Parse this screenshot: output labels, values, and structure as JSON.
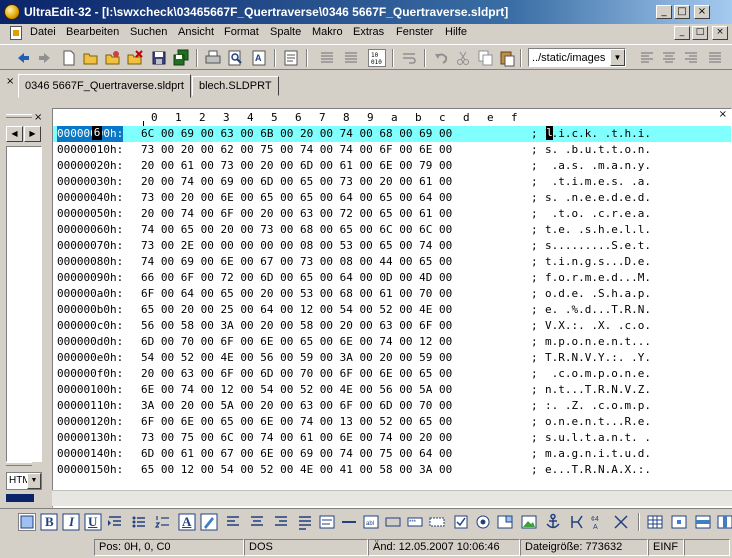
{
  "window": {
    "title": "UltraEdit-32 - [I:\\swxcheck\\03465667F_Quertraverse\\0346 5667F_Quertraverse.sldprt]"
  },
  "window_controls": {
    "minimize": "_",
    "restore": "□",
    "close": "×"
  },
  "mdi_controls": {
    "minimize": "_",
    "restore": "□",
    "close": "×"
  },
  "menu": {
    "items": [
      "Datei",
      "Bearbeiten",
      "Suchen",
      "Ansicht",
      "Format",
      "Spalte",
      "Makro",
      "Extras",
      "Fenster",
      "Hilfe"
    ]
  },
  "toolbar": {
    "path_value": "../static/images",
    "icons": [
      "back-icon",
      "forward-icon",
      "new-file-icon",
      "open-folder-icon",
      "open-recent-icon",
      "close-file-icon",
      "save-icon",
      "save-all-icon",
      "print-icon",
      "print-preview-icon",
      "spell-check-icon",
      "document-icon",
      "list-icon",
      "hex-mode-icon",
      "word-wrap-icon",
      "undo-icon",
      "cut-icon",
      "copy-icon",
      "paste-icon",
      "align-left-icon",
      "align-center-icon",
      "align-right-icon",
      "justify-icon"
    ]
  },
  "tabs": {
    "close": "×",
    "items": [
      {
        "label": "0346 5667F_Quertraverse.sldprt",
        "active": true
      },
      {
        "label": "blech.SLDPRT",
        "active": false
      }
    ]
  },
  "left_panel": {
    "close": "×",
    "prev": "◀",
    "next": "▶",
    "combo_value": "HTML"
  },
  "editor": {
    "corner_close": "×",
    "ruler": [
      "0",
      "1",
      "2",
      "3",
      "4",
      "5",
      "6",
      "7",
      "8",
      "9",
      "a",
      "b",
      "c",
      "d",
      "e",
      "f"
    ],
    "cursor_hex": "6",
    "cursor_ascii": "l",
    "rows": [
      {
        "addr": "00000000h:",
        "hex": "6C 00 69 00 63 00 6B 00 20 00 74 00 68 00 69 00",
        "sep": ";",
        "ascii": "l.i.c.k. .t.h.i."
      },
      {
        "addr": "00000010h:",
        "hex": "73 00 20 00 62 00 75 00 74 00 74 00 6F 00 6E 00",
        "sep": ";",
        "ascii": "s. .b.u.t.t.o.n."
      },
      {
        "addr": "00000020h:",
        "hex": "20 00 61 00 73 00 20 00 6D 00 61 00 6E 00 79 00",
        "sep": ";",
        "ascii": " .a.s. .m.a.n.y."
      },
      {
        "addr": "00000030h:",
        "hex": "20 00 74 00 69 00 6D 00 65 00 73 00 20 00 61 00",
        "sep": ";",
        "ascii": " .t.i.m.e.s. .a."
      },
      {
        "addr": "00000040h:",
        "hex": "73 00 20 00 6E 00 65 00 65 00 64 00 65 00 64 00",
        "sep": ";",
        "ascii": "s. .n.e.e.d.e.d."
      },
      {
        "addr": "00000050h:",
        "hex": "20 00 74 00 6F 00 20 00 63 00 72 00 65 00 61 00",
        "sep": ";",
        "ascii": " .t.o. .c.r.e.a."
      },
      {
        "addr": "00000060h:",
        "hex": "74 00 65 00 20 00 73 00 68 00 65 00 6C 00 6C 00",
        "sep": ";",
        "ascii": "t.e. .s.h.e.l.l."
      },
      {
        "addr": "00000070h:",
        "hex": "73 00 2E 00 00 00 00 00 08 00 53 00 65 00 74 00",
        "sep": ";",
        "ascii": "s.........S.e.t."
      },
      {
        "addr": "00000080h:",
        "hex": "74 00 69 00 6E 00 67 00 73 00 08 00 44 00 65 00",
        "sep": ";",
        "ascii": "t.i.n.g.s...D.e."
      },
      {
        "addr": "00000090h:",
        "hex": "66 00 6F 00 72 00 6D 00 65 00 64 00 0D 00 4D 00",
        "sep": ";",
        "ascii": "f.o.r.m.e.d...M."
      },
      {
        "addr": "000000a0h:",
        "hex": "6F 00 64 00 65 00 20 00 53 00 68 00 61 00 70 00",
        "sep": ";",
        "ascii": "o.d.e. .S.h.a.p."
      },
      {
        "addr": "000000b0h:",
        "hex": "65 00 20 00 25 00 64 00 12 00 54 00 52 00 4E 00",
        "sep": ";",
        "ascii": "e. .%.d...T.R.N."
      },
      {
        "addr": "000000c0h:",
        "hex": "56 00 58 00 3A 00 20 00 58 00 20 00 63 00 6F 00",
        "sep": ";",
        "ascii": "V.X.:. .X. .c.o."
      },
      {
        "addr": "000000d0h:",
        "hex": "6D 00 70 00 6F 00 6E 00 65 00 6E 00 74 00 12 00",
        "sep": ";",
        "ascii": "m.p.o.n.e.n.t..."
      },
      {
        "addr": "000000e0h:",
        "hex": "54 00 52 00 4E 00 56 00 59 00 3A 00 20 00 59 00",
        "sep": ";",
        "ascii": "T.R.N.V.Y.:. .Y."
      },
      {
        "addr": "000000f0h:",
        "hex": "20 00 63 00 6F 00 6D 00 70 00 6F 00 6E 00 65 00",
        "sep": ";",
        "ascii": " .c.o.m.p.o.n.e."
      },
      {
        "addr": "00000100h:",
        "hex": "6E 00 74 00 12 00 54 00 52 00 4E 00 56 00 5A 00",
        "sep": ";",
        "ascii": "n.t...T.R.N.V.Z."
      },
      {
        "addr": "00000110h:",
        "hex": "3A 00 20 00 5A 00 20 00 63 00 6F 00 6D 00 70 00",
        "sep": ";",
        "ascii": ":. .Z. .c.o.m.p."
      },
      {
        "addr": "00000120h:",
        "hex": "6F 00 6E 00 65 00 6E 00 74 00 13 00 52 00 65 00",
        "sep": ";",
        "ascii": "o.n.e.n.t...R.e."
      },
      {
        "addr": "00000130h:",
        "hex": "73 00 75 00 6C 00 74 00 61 00 6E 00 74 00 20 00",
        "sep": ";",
        "ascii": "s.u.l.t.a.n.t. ."
      },
      {
        "addr": "00000140h:",
        "hex": "6D 00 61 00 67 00 6E 00 69 00 74 00 75 00 64 00",
        "sep": ";",
        "ascii": "m.a.g.n.i.t.u.d."
      },
      {
        "addr": "00000150h:",
        "hex": "65 00 12 00 54 00 52 00 4E 00 41 00 58 00 3A 00",
        "sep": ";",
        "ascii": "e...T.R.N.A.X.:."
      }
    ]
  },
  "bottom_toolbar": {
    "icons": [
      "html-view-icon",
      "bold-icon",
      "italic-icon",
      "underline-icon",
      "indent-icon",
      "bullet-list-icon",
      "numbered-list-icon",
      "font-color-icon",
      "highlight-icon",
      "align-left-icon",
      "align-center-icon",
      "align-right-icon",
      "paragraph-icon",
      "form-icon",
      "horizontal-rule-icon",
      "textarea-icon",
      "button-icon",
      "input-icon",
      "hidden-field-icon",
      "checkbox-icon",
      "radio-icon",
      "select-icon",
      "image-icon",
      "anchor-icon",
      "symbol-icon",
      "special-char-icon",
      "tag-icon",
      "table-icon",
      "table-cell-icon",
      "table-row-icon"
    ],
    "labels": {
      "bold": "B",
      "italic": "I",
      "underline": "U",
      "font": "A"
    }
  },
  "status": {
    "position": "Pos: 0H, 0, C0",
    "format": "DOS",
    "modified": "Änd: 12.05.2007 10:06:46",
    "size": "Dateigröße: 773632",
    "mode": "EINF"
  }
}
